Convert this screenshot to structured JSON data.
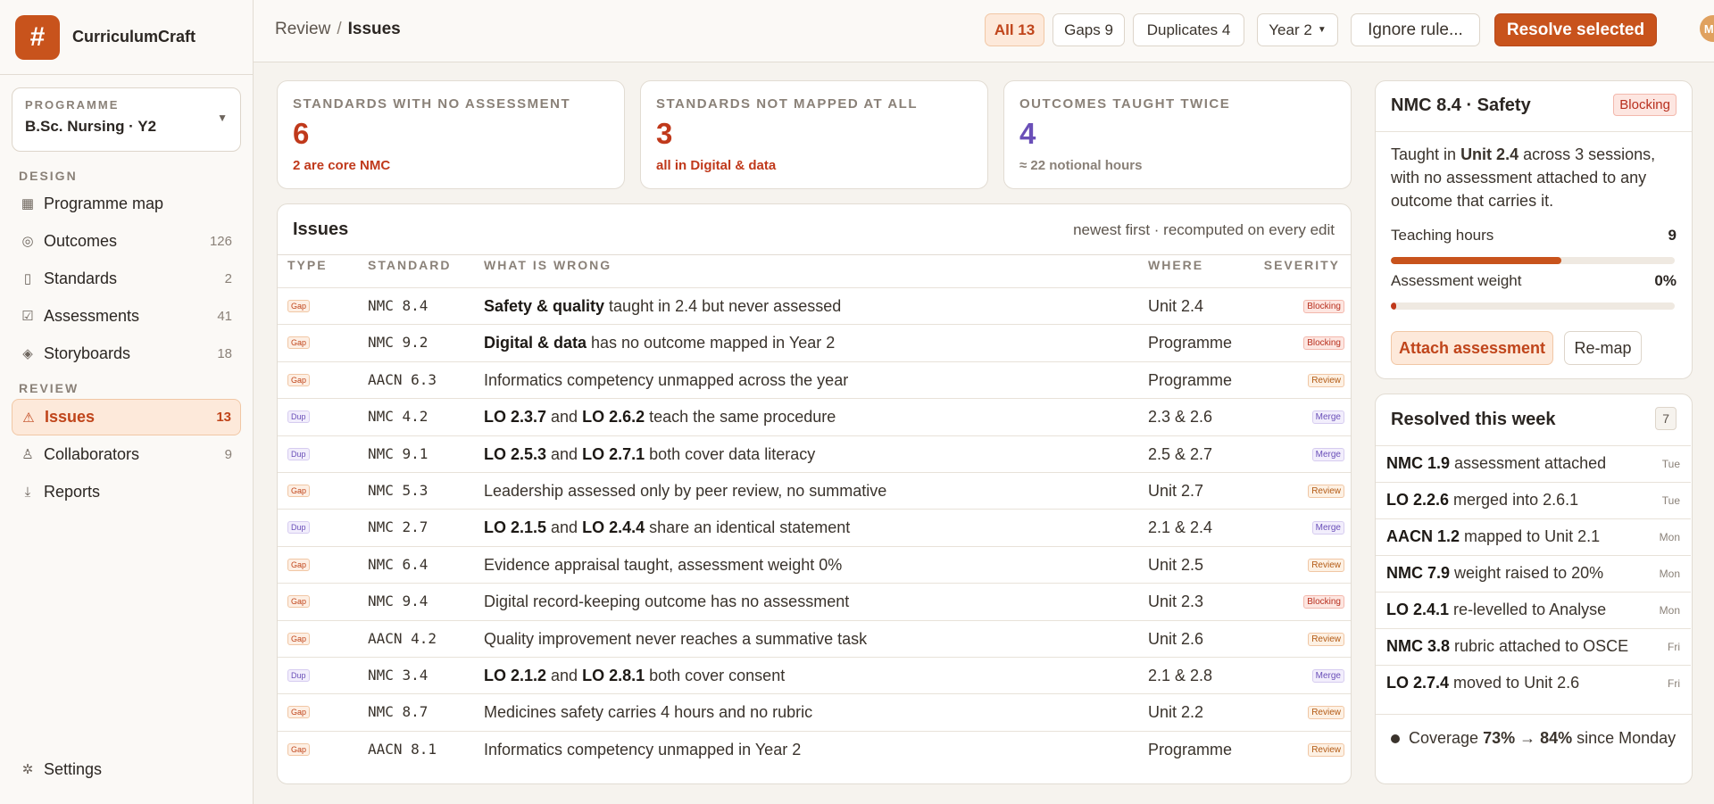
{
  "app": {
    "name": "CurriculumCraft",
    "logo_glyph": "#"
  },
  "sidebar": {
    "programme_label": "PROGRAMME",
    "programme_value": "B.Sc. Nursing · Y2",
    "design_label": "DESIGN",
    "review_label": "REVIEW",
    "design_items": [
      {
        "label": "Programme map",
        "count": "",
        "icon": "grid-icon"
      },
      {
        "label": "Outcomes",
        "count": "126",
        "icon": "target-icon"
      },
      {
        "label": "Standards",
        "count": "2",
        "icon": "book-icon"
      },
      {
        "label": "Assessments",
        "count": "41",
        "icon": "checkbox-icon"
      },
      {
        "label": "Storyboards",
        "count": "18",
        "icon": "layers-icon"
      }
    ],
    "review_items": [
      {
        "label": "Issues",
        "count": "13",
        "icon": "warning-icon"
      },
      {
        "label": "Collaborators",
        "count": "9",
        "icon": "user-icon"
      },
      {
        "label": "Reports",
        "count": "",
        "icon": "download-icon"
      }
    ],
    "settings_label": "Settings"
  },
  "topbar": {
    "crumb_parent": "Review",
    "crumb_sep": "/",
    "crumb_current": "Issues",
    "filter_all": "All 13",
    "filter_gaps": "Gaps 9",
    "filter_dups": "Duplicates 4",
    "year_select": "Year 2",
    "ignore_button": "Ignore rule...",
    "resolve_button": "Resolve selected",
    "avatar_initials": "MR"
  },
  "stats": [
    {
      "label": "STANDARDS WITH NO ASSESSMENT",
      "value": "6",
      "sub": "2 are core NMC",
      "color": "#c0391b",
      "sub_color": "#c0391b"
    },
    {
      "label": "STANDARDS NOT MAPPED AT ALL",
      "value": "3",
      "sub": "all in Digital & data",
      "color": "#c0391b",
      "sub_color": "#c0391b"
    },
    {
      "label": "OUTCOMES TAUGHT TWICE",
      "value": "4",
      "sub": "≈ 22 notional hours",
      "color": "#6a4fb8",
      "sub_color": "#8a8178"
    }
  ],
  "issues": {
    "title": "Issues",
    "meta": "newest first · recomputed on every edit",
    "columns": [
      "TYPE",
      "STANDARD",
      "WHAT IS WRONG",
      "WHERE",
      "SEVERITY"
    ],
    "rows": [
      {
        "type": "Gap",
        "std": "NMC 8.4",
        "b1": "Safety & quality",
        "t1": " taught in 2.4 but never assessed",
        "b2": "",
        "t2": "",
        "where": "Unit 2.4",
        "sev": "Blocking"
      },
      {
        "type": "Gap",
        "std": "NMC 9.2",
        "b1": "Digital & data",
        "t1": " has no outcome mapped in Year 2",
        "b2": "",
        "t2": "",
        "where": "Programme",
        "sev": "Blocking"
      },
      {
        "type": "Gap",
        "std": "AACN 6.3",
        "b1": "",
        "t1": "Informatics competency unmapped across the year",
        "b2": "",
        "t2": "",
        "where": "Programme",
        "sev": "Review"
      },
      {
        "type": "Dup",
        "std": "NMC 4.2",
        "b1": "LO 2.3.7",
        "t1": " and ",
        "b2": "LO 2.6.2",
        "t2": " teach the same procedure",
        "where": "2.3 & 2.6",
        "sev": "Merge"
      },
      {
        "type": "Dup",
        "std": "NMC 9.1",
        "b1": "LO 2.5.3",
        "t1": " and ",
        "b2": "LO 2.7.1",
        "t2": " both cover data literacy",
        "where": "2.5 & 2.7",
        "sev": "Merge"
      },
      {
        "type": "Gap",
        "std": "NMC 5.3",
        "b1": "",
        "t1": "Leadership assessed only by peer review, no summative",
        "b2": "",
        "t2": "",
        "where": "Unit 2.7",
        "sev": "Review"
      },
      {
        "type": "Dup",
        "std": "NMC 2.7",
        "b1": "LO 2.1.5",
        "t1": " and ",
        "b2": "LO 2.4.4",
        "t2": " share an identical statement",
        "where": "2.1 & 2.4",
        "sev": "Merge"
      },
      {
        "type": "Gap",
        "std": "NMC 6.4",
        "b1": "",
        "t1": "Evidence appraisal taught, assessment weight 0%",
        "b2": "",
        "t2": "",
        "where": "Unit 2.5",
        "sev": "Review"
      },
      {
        "type": "Gap",
        "std": "NMC 9.4",
        "b1": "",
        "t1": "Digital record-keeping outcome has no assessment",
        "b2": "",
        "t2": "",
        "where": "Unit 2.3",
        "sev": "Blocking"
      },
      {
        "type": "Gap",
        "std": "AACN 4.2",
        "b1": "",
        "t1": "Quality improvement never reaches a summative task",
        "b2": "",
        "t2": "",
        "where": "Unit 2.6",
        "sev": "Review"
      },
      {
        "type": "Dup",
        "std": "NMC 3.4",
        "b1": "LO 2.1.2",
        "t1": " and ",
        "b2": "LO 2.8.1",
        "t2": " both cover consent",
        "where": "2.1 & 2.8",
        "sev": "Merge"
      },
      {
        "type": "Gap",
        "std": "NMC 8.7",
        "b1": "",
        "t1": "Medicines safety carries 4 hours and no rubric",
        "b2": "",
        "t2": "",
        "where": "Unit 2.2",
        "sev": "Review"
      },
      {
        "type": "Gap",
        "std": "AACN 8.1",
        "b1": "",
        "t1": "Informatics competency unmapped in Year 2",
        "b2": "",
        "t2": "",
        "where": "Programme",
        "sev": "Review"
      }
    ]
  },
  "detail": {
    "title": "NMC 8.4 · Safety",
    "badge": "Blocking",
    "text_pre": "Taught in ",
    "text_bold": "Unit 2.4",
    "text_post": " across 3 sessions, with no assessment attached to any outcome that carries it.",
    "teaching_label": "Teaching hours",
    "teaching_value": "9",
    "teaching_fraction": 0.6,
    "weight_label": "Assessment weight",
    "weight_value": "0%",
    "weight_fraction": 0.02,
    "attach_button": "Attach assessment",
    "remap_button": "Re-map"
  },
  "resolved": {
    "title": "Resolved this week",
    "count": "7",
    "items": [
      {
        "bold": "NMC 1.9",
        "text": " assessment attached",
        "day": "Tue"
      },
      {
        "bold": "LO 2.2.6",
        "text": " merged into 2.6.1",
        "day": "Tue"
      },
      {
        "bold": "AACN 1.2",
        "text": " mapped to Unit 2.1",
        "day": "Mon"
      },
      {
        "bold": "NMC 7.9",
        "text": " weight raised to 20%",
        "day": "Mon"
      },
      {
        "bold": "LO 2.4.1",
        "text": " re-levelled to Analyse",
        "day": "Mon"
      },
      {
        "bold": "NMC 3.8",
        "text": " rubric attached to OSCE",
        "day": "Fri"
      },
      {
        "bold": "LO 2.7.4",
        "text": " moved to Unit 2.6",
        "day": "Fri"
      }
    ],
    "coverage_pre": "Coverage ",
    "coverage_bold": "73% → 84%",
    "coverage_post": " since Monday"
  }
}
